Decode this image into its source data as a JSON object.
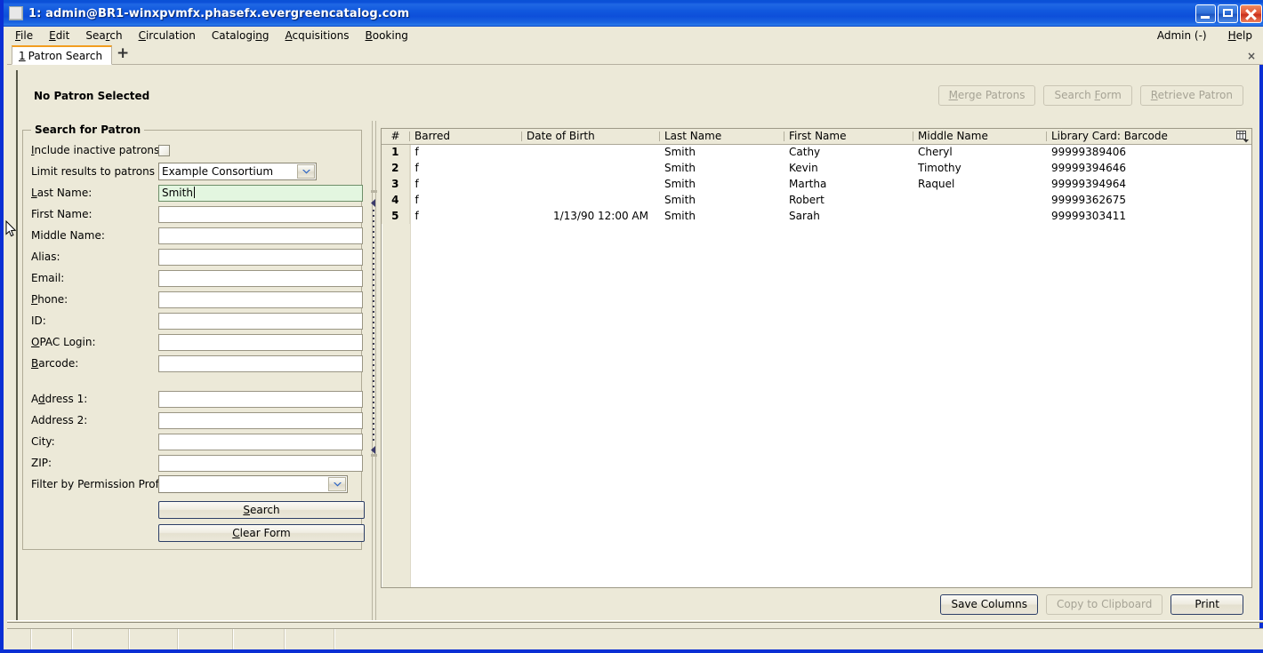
{
  "window": {
    "title": "1: admin@BR1-winxpvmfx.phasefx.evergreencatalog.com",
    "minimize_label": "Minimize",
    "maximize_label": "Maximize",
    "close_label": "Close"
  },
  "menubar": {
    "items": [
      {
        "label": "File",
        "accel": "F"
      },
      {
        "label": "Edit",
        "accel": "E"
      },
      {
        "label": "Search",
        "accel": "r"
      },
      {
        "label": "Circulation",
        "accel": "C"
      },
      {
        "label": "Cataloging",
        "accel": "n"
      },
      {
        "label": "Acquisitions",
        "accel": "A"
      },
      {
        "label": "Booking",
        "accel": "B"
      }
    ],
    "admin_label": "Admin (-)",
    "help_label": "Help",
    "help_accel": "H"
  },
  "tabs": {
    "active": {
      "number": "1",
      "label": "Patron Search"
    },
    "new_tab_label": "+",
    "close_label": "×"
  },
  "patron_header": {
    "status": "No Patron Selected",
    "buttons": [
      {
        "label": "Merge Patrons",
        "accel": "M",
        "disabled": true
      },
      {
        "label": "Search Form",
        "accel": "F",
        "disabled": true
      },
      {
        "label": "Retrieve Patron",
        "accel": "R",
        "disabled": true
      }
    ]
  },
  "search_form": {
    "legend": "Search for Patron",
    "include_inactive": {
      "label": "Include inactive patrons?",
      "accel": "I",
      "checked": false
    },
    "limit_results": {
      "label": "Limit results to patrons in",
      "value": "Example Consortium"
    },
    "fields": [
      {
        "label": "Last Name:",
        "accel": "L",
        "value": "Smith",
        "active": true
      },
      {
        "label": "First Name:",
        "accel": "",
        "value": "",
        "active": false
      },
      {
        "label": "Middle Name:",
        "accel": "",
        "value": "",
        "active": false
      },
      {
        "label": "Alias:",
        "accel": "",
        "value": "",
        "active": false
      },
      {
        "label": "Email:",
        "accel": "",
        "value": "",
        "active": false
      },
      {
        "label": "Phone:",
        "accel": "P",
        "value": "",
        "active": false
      },
      {
        "label": "ID:",
        "accel": "",
        "value": "",
        "active": false
      },
      {
        "label": "OPAC Login:",
        "accel": "O",
        "value": "",
        "active": false
      },
      {
        "label": "Barcode:",
        "accel": "B",
        "value": "",
        "active": false
      }
    ],
    "address_fields": [
      {
        "label": "Address 1:",
        "accel": "d",
        "value": ""
      },
      {
        "label": "Address 2:",
        "accel": "",
        "value": ""
      },
      {
        "label": "City:",
        "accel": "",
        "value": ""
      },
      {
        "label": "ZIP:",
        "accel": "",
        "value": ""
      }
    ],
    "permission_profile": {
      "label": "Filter by Permission Profile:",
      "value": ""
    },
    "search_button": {
      "label": "Search",
      "accel": "S"
    },
    "clear_button": {
      "label": "Clear Form",
      "accel": "C"
    }
  },
  "results": {
    "columns": [
      "#",
      "Barred",
      "Date of Birth",
      "Last Name",
      "First Name",
      "Middle Name",
      "Library Card: Barcode"
    ],
    "rows": [
      {
        "num": "1",
        "barred": "f",
        "dob": "",
        "last": "Smith",
        "first": "Cathy",
        "middle": "Cheryl",
        "barcode": "99999389406"
      },
      {
        "num": "2",
        "barred": "f",
        "dob": "",
        "last": "Smith",
        "first": "Kevin",
        "middle": "Timothy",
        "barcode": "99999394646"
      },
      {
        "num": "3",
        "barred": "f",
        "dob": "",
        "last": "Smith",
        "first": "Martha",
        "middle": "Raquel",
        "barcode": "99999394964"
      },
      {
        "num": "4",
        "barred": "f",
        "dob": "",
        "last": "Smith",
        "first": "Robert",
        "middle": "",
        "barcode": "99999362675"
      },
      {
        "num": "5",
        "barred": "f",
        "dob": "1/13/90 12:00 AM",
        "last": "Smith",
        "first": "Sarah",
        "middle": "",
        "barcode": "99999303411"
      }
    ],
    "column_picker_label": "Column picker",
    "footer_buttons": [
      {
        "label": "Save Columns",
        "disabled": false
      },
      {
        "label": "Copy to Clipboard",
        "disabled": true
      },
      {
        "label": "Print",
        "disabled": false
      }
    ]
  },
  "colors": {
    "titlebar_blue": "#0b4fd8",
    "window_border": "#0a2fd4",
    "chrome_beige": "#ece9d8",
    "tab_accent": "#f29d20",
    "active_field_green": "#e3f6e0"
  }
}
